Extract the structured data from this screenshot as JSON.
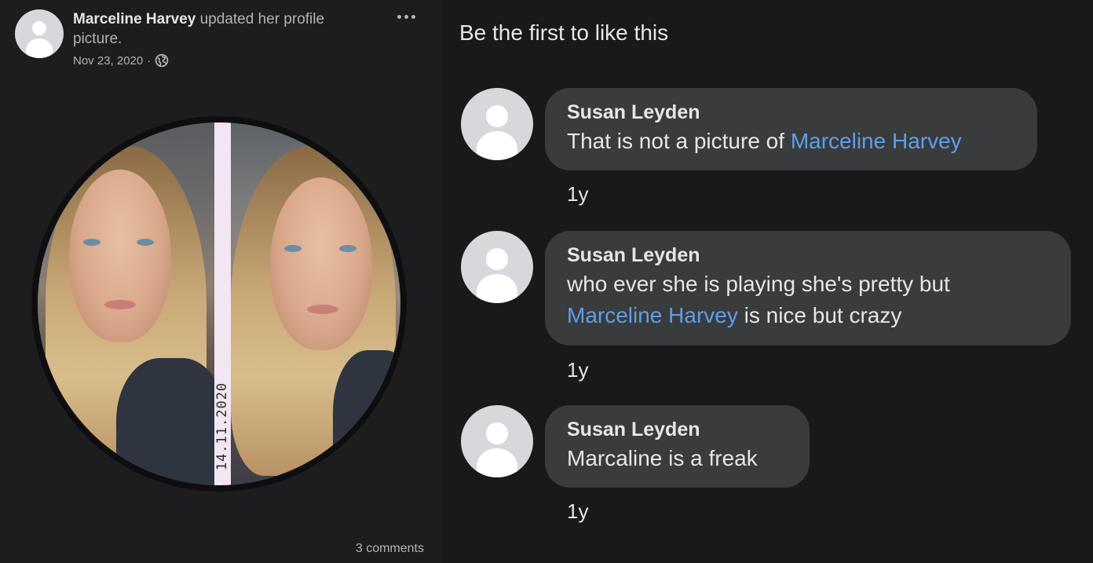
{
  "post": {
    "author": "Marceline Harvey",
    "action_text": " updated her profile picture.",
    "date": "Nov 23, 2020",
    "separator": "·",
    "visibility_icon": "globe-icon",
    "more_icon": "more-options-icon",
    "photo_stamp": "14.11.2020",
    "comments_count": "3 comments"
  },
  "reactions": {
    "likes_text": "Be the first to like this"
  },
  "comments": [
    {
      "author": "Susan Leyden",
      "text_before": "That is not a picture of ",
      "mention": "Marceline Harvey",
      "text_after": "",
      "time": "1y"
    },
    {
      "author": "Susan Leyden",
      "text_before": "who ever she is playing she's pretty but ",
      "mention": "Marceline Harvey",
      "text_after": " is nice but crazy",
      "time": "1y"
    },
    {
      "author": "Susan Leyden",
      "text_before": "Marcaline is a freak",
      "mention": "",
      "text_after": "",
      "time": "1y"
    }
  ],
  "colors": {
    "background": "#18191a",
    "bubble": "#3a3b3c",
    "mention": "#5d9fea",
    "secondary_text": "#b0b3b8"
  }
}
